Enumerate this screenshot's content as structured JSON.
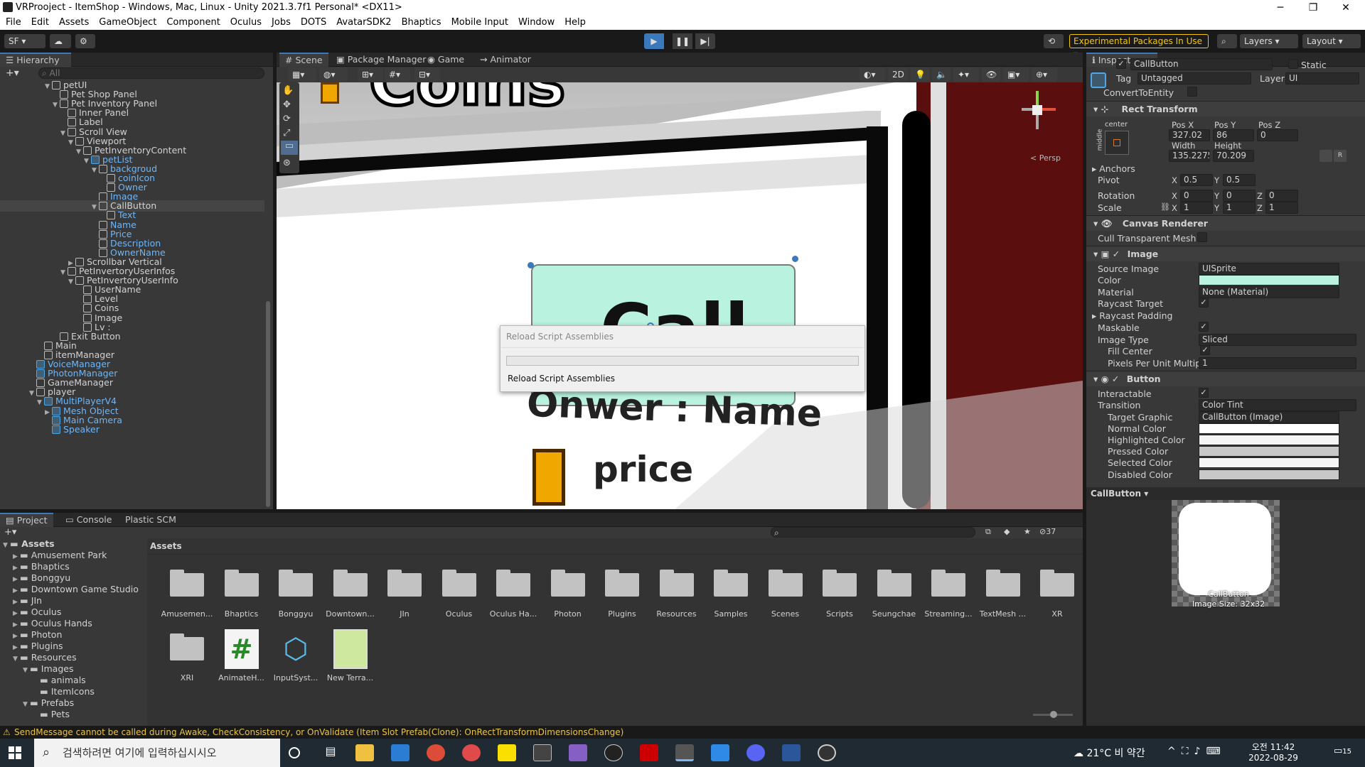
{
  "window": {
    "title": "VRProoject - ItemShop - Windows, Mac, Linux - Unity 2021.3.7f1 Personal* <DX11>",
    "min": "─",
    "max": "❐",
    "close": "✕"
  },
  "menu": [
    "File",
    "Edit",
    "Assets",
    "GameObject",
    "Component",
    "Oculus",
    "Jobs",
    "DOTS",
    "AvatarSDK2",
    "Bhaptics",
    "Mobile Input",
    "Window",
    "Help"
  ],
  "toolbar": {
    "account": "SF ▾",
    "experimental": "Experimental Packages In Use ▾",
    "layers": "Layers",
    "layout": "Layout"
  },
  "hierarchy": {
    "tab": "Hierarchy",
    "search_placeholder": "All",
    "rows": [
      {
        "label": "petUI",
        "indent": 5,
        "arrow": "▼",
        "pf": false,
        "blue": false
      },
      {
        "label": "Pet Shop Panel",
        "indent": 6,
        "arrow": "",
        "pf": false,
        "blue": false
      },
      {
        "label": "Pet Inventory Panel",
        "indent": 6,
        "arrow": "▼",
        "pf": false,
        "blue": false
      },
      {
        "label": "Inner Panel",
        "indent": 7,
        "arrow": "",
        "pf": false,
        "blue": false
      },
      {
        "label": "Label",
        "indent": 7,
        "arrow": "",
        "pf": false,
        "blue": false
      },
      {
        "label": "Scroll View",
        "indent": 7,
        "arrow": "▼",
        "pf": false,
        "blue": false
      },
      {
        "label": "Viewport",
        "indent": 8,
        "arrow": "▼",
        "pf": false,
        "blue": false
      },
      {
        "label": "PetInventoryContent",
        "indent": 9,
        "arrow": "▼",
        "pf": false,
        "blue": false
      },
      {
        "label": "petList",
        "indent": 10,
        "arrow": "▼",
        "pf": true,
        "blue": true
      },
      {
        "label": "backgroud",
        "indent": 11,
        "arrow": "▼",
        "pf": false,
        "blue": true
      },
      {
        "label": "coinIcon",
        "indent": 12,
        "arrow": "",
        "pf": false,
        "blue": true
      },
      {
        "label": "Owner",
        "indent": 12,
        "arrow": "",
        "pf": false,
        "blue": true
      },
      {
        "label": "Image",
        "indent": 11,
        "arrow": "",
        "pf": false,
        "blue": true
      },
      {
        "label": "CallButton",
        "indent": 11,
        "arrow": "▼",
        "pf": false,
        "blue": false,
        "sel": true
      },
      {
        "label": "Text",
        "indent": 12,
        "arrow": "",
        "pf": false,
        "blue": true
      },
      {
        "label": "Name",
        "indent": 11,
        "arrow": "",
        "pf": false,
        "blue": true
      },
      {
        "label": "Price",
        "indent": 11,
        "arrow": "",
        "pf": false,
        "blue": true
      },
      {
        "label": "Description",
        "indent": 11,
        "arrow": "",
        "pf": false,
        "blue": true
      },
      {
        "label": "OwnerName",
        "indent": 11,
        "arrow": "",
        "pf": false,
        "blue": true
      },
      {
        "label": "Scrollbar Vertical",
        "indent": 8,
        "arrow": "▶",
        "pf": false,
        "blue": false
      },
      {
        "label": "PetInvertoryUserInfos",
        "indent": 7,
        "arrow": "▼",
        "pf": false,
        "blue": false
      },
      {
        "label": "PetInvertoryUserInfo",
        "indent": 8,
        "arrow": "▼",
        "pf": false,
        "blue": false
      },
      {
        "label": "UserName",
        "indent": 9,
        "arrow": "",
        "pf": false,
        "blue": false
      },
      {
        "label": "Level",
        "indent": 9,
        "arrow": "",
        "pf": false,
        "blue": false
      },
      {
        "label": "Coins",
        "indent": 9,
        "arrow": "",
        "pf": false,
        "blue": false
      },
      {
        "label": "Image",
        "indent": 9,
        "arrow": "",
        "pf": false,
        "blue": false
      },
      {
        "label": "Lv :",
        "indent": 9,
        "arrow": "",
        "pf": false,
        "blue": false
      },
      {
        "label": "Exit Button",
        "indent": 6,
        "arrow": "",
        "pf": false,
        "blue": false
      },
      {
        "label": "Main",
        "indent": 4,
        "arrow": "",
        "pf": false,
        "blue": false
      },
      {
        "label": "itemManager",
        "indent": 4,
        "arrow": "",
        "pf": false,
        "blue": false
      },
      {
        "label": "VoiceManager",
        "indent": 3,
        "arrow": "",
        "pf": true,
        "blue": true
      },
      {
        "label": "PhotonManager",
        "indent": 3,
        "arrow": "",
        "pf": true,
        "blue": true
      },
      {
        "label": "GameManager",
        "indent": 3,
        "arrow": "",
        "pf": false,
        "blue": false
      },
      {
        "label": "player",
        "indent": 3,
        "arrow": "▼",
        "pf": false,
        "blue": false
      },
      {
        "label": "MultiPlayerV4",
        "indent": 4,
        "arrow": "▼",
        "pf": true,
        "blue": true
      },
      {
        "label": "Mesh Object",
        "indent": 5,
        "arrow": "▶",
        "pf": true,
        "blue": true
      },
      {
        "label": "Main Camera",
        "indent": 5,
        "arrow": "",
        "pf": true,
        "blue": true
      },
      {
        "label": "Speaker",
        "indent": 5,
        "arrow": "",
        "pf": true,
        "blue": true
      }
    ]
  },
  "scene": {
    "tabs": [
      "Scene",
      "Package Manager",
      "Game",
      "Animator"
    ],
    "mode_2d": "2D",
    "persp": "< Persp",
    "ui_text": {
      "coins": "Coins",
      "call": "Call",
      "owner": "Onwer : Name",
      "price": "price"
    },
    "dialog": {
      "title": "Reload Script Assemblies",
      "message": "Reload Script Assemblies",
      "progress": 0
    }
  },
  "inspector": {
    "tab": "Inspector",
    "object_name": "CallButton",
    "static_label": "Static",
    "tag_label": "Tag",
    "tag_value": "Untagged",
    "layer_label": "Layer",
    "layer_value": "UI",
    "convert_label": "ConvertToEntity",
    "rect": {
      "title": "Rect Transform",
      "anchor_preset": "center",
      "side": "middle",
      "posx_label": "Pos X",
      "posy_label": "Pos Y",
      "posz_label": "Pos Z",
      "posx": "327.02",
      "posy": "86",
      "posz": "0",
      "width_label": "Width",
      "height_label": "Height",
      "width": "135.2275",
      "height": "70.209",
      "anchors": "Anchors",
      "pivot": "Pivot",
      "pivot_x": "0.5",
      "pivot_y": "0.5",
      "rotation": "Rotation",
      "rot_x": "0",
      "rot_y": "0",
      "rot_z": "0",
      "scale": "Scale",
      "scale_x": "1",
      "scale_y": "1",
      "scale_z": "1"
    },
    "canvas_renderer": {
      "title": "Canvas Renderer",
      "cull": "Cull Transparent Mesh"
    },
    "image": {
      "title": "Image",
      "source_label": "Source Image",
      "source": "UISprite",
      "color_label": "Color",
      "color": "#b9f2de",
      "material_label": "Material",
      "material": "None (Material)",
      "raycast_target": "Raycast Target",
      "raycast_padding": "Raycast Padding",
      "maskable": "Maskable",
      "type_label": "Image Type",
      "type": "Sliced",
      "fill_center": "Fill Center",
      "ppu_label": "Pixels Per Unit Multipl",
      "ppu": "1"
    },
    "button": {
      "title": "Button",
      "interactable": "Interactable",
      "transition_label": "Transition",
      "transition": "Color Tint",
      "target_label": "Target Graphic",
      "target": "CallButton (Image)",
      "normal": "Normal Color",
      "highlighted": "Highlighted Color",
      "pressed": "Pressed Color",
      "selected": "Selected Color",
      "disabled": "Disabled Color",
      "normal_c": "#ffffff",
      "highlighted_c": "#f5f5f5",
      "pressed_c": "#c8c8c8",
      "selected_c": "#f5f5f5",
      "disabled_c": "#c8c8c8"
    },
    "preview": {
      "title": "CallButton ▾",
      "name": "CallButton",
      "size": "Image Size: 32x32"
    }
  },
  "project": {
    "tabs": [
      "Project",
      "Console",
      "Plastic SCM"
    ],
    "hidden_count": "37",
    "breadcrumb": "Assets",
    "tree": [
      {
        "label": "Assets",
        "indent": 0,
        "arrow": "▼",
        "bold": true
      },
      {
        "label": "Amusement Park",
        "indent": 1,
        "arrow": "▶"
      },
      {
        "label": "Bhaptics",
        "indent": 1,
        "arrow": "▶"
      },
      {
        "label": "Bonggyu",
        "indent": 1,
        "arrow": "▶"
      },
      {
        "label": "Downtown Game Studio",
        "indent": 1,
        "arrow": "▶"
      },
      {
        "label": "JIn",
        "indent": 1,
        "arrow": "▶"
      },
      {
        "label": "Oculus",
        "indent": 1,
        "arrow": "▶"
      },
      {
        "label": "Oculus Hands",
        "indent": 1,
        "arrow": "▶"
      },
      {
        "label": "Photon",
        "indent": 1,
        "arrow": "▶"
      },
      {
        "label": "Plugins",
        "indent": 1,
        "arrow": "▶"
      },
      {
        "label": "Resources",
        "indent": 1,
        "arrow": "▼"
      },
      {
        "label": "Images",
        "indent": 2,
        "arrow": "▼"
      },
      {
        "label": "animals",
        "indent": 3,
        "arrow": ""
      },
      {
        "label": "ItemIcons",
        "indent": 3,
        "arrow": ""
      },
      {
        "label": "Prefabs",
        "indent": 2,
        "arrow": "▼"
      },
      {
        "label": "Pets",
        "indent": 3,
        "arrow": ""
      }
    ],
    "assets": [
      {
        "label": "Amusemen...",
        "kind": "folder"
      },
      {
        "label": "Bhaptics",
        "kind": "folder"
      },
      {
        "label": "Bonggyu",
        "kind": "folder"
      },
      {
        "label": "Downtown...",
        "kind": "folder"
      },
      {
        "label": "JIn",
        "kind": "folder"
      },
      {
        "label": "Oculus",
        "kind": "folder"
      },
      {
        "label": "Oculus Ha...",
        "kind": "folder"
      },
      {
        "label": "Photon",
        "kind": "folder"
      },
      {
        "label": "Plugins",
        "kind": "folder"
      },
      {
        "label": "Resources",
        "kind": "folder"
      },
      {
        "label": "Samples",
        "kind": "folder"
      },
      {
        "label": "Scenes",
        "kind": "folder"
      },
      {
        "label": "Scripts",
        "kind": "folder"
      },
      {
        "label": "Seungchae",
        "kind": "folder"
      },
      {
        "label": "Streaming...",
        "kind": "folder"
      },
      {
        "label": "TextMesh ...",
        "kind": "folder"
      },
      {
        "label": "XR",
        "kind": "folder"
      },
      {
        "label": "XRI",
        "kind": "folder"
      },
      {
        "label": "AnimateH...",
        "kind": "script"
      },
      {
        "label": "InputSyst...",
        "kind": "input"
      },
      {
        "label": "New Terra...",
        "kind": "terrain"
      }
    ]
  },
  "status": {
    "message": "SendMessage cannot be called during Awake, CheckConsistency, or OnValidate (Item Slot Prefab(Clone): OnRectTransformDimensionsChange)"
  },
  "taskbar": {
    "search_placeholder": "검색하려면 여기에 입력하십시시오",
    "weather": "21°C 비 약간",
    "time": "오전 11:42",
    "date": "2022-08-29",
    "notif": "15"
  }
}
